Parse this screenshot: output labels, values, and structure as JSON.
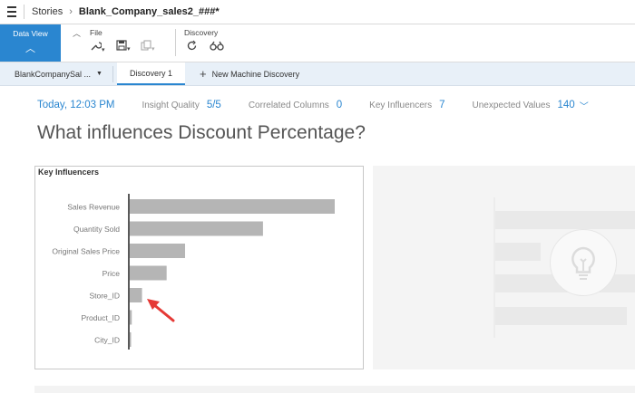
{
  "topbar": {
    "breadcrumb_root": "Stories",
    "breadcrumb_sep": "›",
    "breadcrumb_current": "Blank_Company_sales2_###*"
  },
  "toolbar": {
    "data_view_label": "Data View",
    "file_label": "File",
    "discovery_label": "Discovery"
  },
  "tabs": {
    "story_tab": "BlankCompanySal ...",
    "active_tab": "Discovery 1",
    "new_tab": "New Machine Discovery"
  },
  "stats": {
    "date": "Today,  12:03 PM",
    "insight_quality_label": "Insight Quality",
    "insight_quality_value": "5/5",
    "correlated_label": "Correlated Columns",
    "correlated_value": "0",
    "key_influencers_label": "Key Influencers",
    "key_influencers_value": "7",
    "unexpected_label": "Unexpected Values",
    "unexpected_value": "140"
  },
  "page_title": "What influences Discount Percentage?",
  "chart_data": {
    "type": "bar",
    "orientation": "horizontal",
    "title": "Key Influencers",
    "categories": [
      "Sales Revenue",
      "Quantity Sold",
      "Original Sales Price",
      "Price",
      "Store_ID",
      "Product_ID",
      "City_ID"
    ],
    "values": [
      100,
      65,
      27,
      18,
      6,
      1,
      0.3
    ],
    "xlim": [
      0,
      100
    ],
    "bar_color": "#b5b5b5",
    "annotation": "red arrow pointing to Store_ID"
  },
  "colors": {
    "accent": "#2a86d0",
    "arrow": "#e53935"
  }
}
